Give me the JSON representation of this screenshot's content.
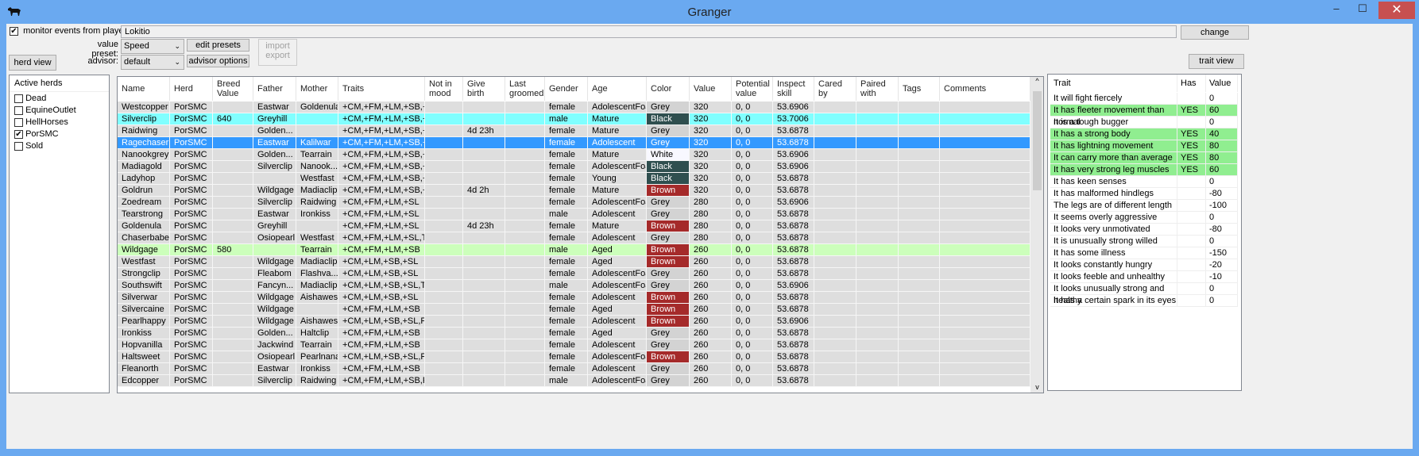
{
  "window": {
    "title": "Granger",
    "minimize": "–",
    "maximize": "☐",
    "close": "✕"
  },
  "top": {
    "monitor_label": "monitor events from players:",
    "monitor_checked": true,
    "players": "Lokitio",
    "change": "change",
    "value_preset_label": "value preset:",
    "value_preset": "Speed",
    "edit_presets": "edit presets",
    "advisor_label": "advisor:",
    "advisor": "default",
    "advisor_options": "advisor options",
    "import_export": [
      "import",
      "export"
    ],
    "herd_view": "herd view",
    "trait_view": "trait view"
  },
  "herds": {
    "title": "Active herds",
    "items": [
      {
        "name": "Dead",
        "checked": false
      },
      {
        "name": "EquineOutlet",
        "checked": false
      },
      {
        "name": "HellHorses",
        "checked": false
      },
      {
        "name": "PorSMC",
        "checked": true
      },
      {
        "name": "Sold",
        "checked": false
      }
    ]
  },
  "grid": {
    "columns": [
      "Name",
      "Herd",
      "Breed Value",
      "Father",
      "Mother",
      "Traits",
      "Not in mood",
      "Give birth",
      "Last groomed",
      "Gender",
      "Age",
      "Color",
      "Value",
      "Potential value",
      "Inspect skill",
      "Cared by",
      "Paired with",
      "Tags",
      "Comments"
    ],
    "colors": {
      "Grey": "#d3d3d3",
      "Black": "#2f4f4f",
      "Brown": "#a52a2a",
      "White": "#f8f8ff",
      "row": "#dedede",
      "highlight": "#80ffff",
      "selected": "#3399ff",
      "breed": "#ccffbb"
    },
    "rows": [
      [
        "Westcopper",
        "PorSMC",
        "",
        "Eastwar",
        "Goldenula",
        "+CM,+FM,+LM,+SB,+SL",
        "",
        "",
        "",
        "female",
        "AdolescentFoal",
        "Grey",
        "320",
        "0, 0",
        "53.6906",
        "",
        "",
        "",
        "",
        ""
      ],
      [
        "Silverclip",
        "PorSMC",
        "640",
        "Greyhill",
        "",
        "+CM,+FM,+LM,+SB,+SL",
        "",
        "",
        "",
        "male",
        "Mature",
        "Black",
        "320",
        "0, 0",
        "53.7006",
        "",
        "",
        "",
        "",
        "highlight"
      ],
      [
        "Raidwing",
        "PorSMC",
        "",
        "Golden...",
        "",
        "+CM,+FM,+LM,+SB,+SL",
        "",
        "4d 23h",
        "",
        "female",
        "Mature",
        "Grey",
        "320",
        "0, 0",
        "53.6878",
        "",
        "",
        "",
        "",
        ""
      ],
      [
        "Ragechaser",
        "PorSMC",
        "",
        "Eastwar",
        "Kalilwar",
        "+CM,+FM,+LM,+SB,+SL",
        "",
        "",
        "",
        "female",
        "Adolescent",
        "Grey",
        "320",
        "0, 0",
        "53.6878",
        "",
        "",
        "",
        "",
        "selected"
      ],
      [
        "Nanookgrey",
        "PorSMC",
        "",
        "Golden...",
        "Tearrain",
        "+CM,+FM,+LM,+SB,+SL",
        "",
        "",
        "",
        "female",
        "Mature",
        "White",
        "320",
        "0, 0",
        "53.6906",
        "",
        "",
        "",
        "",
        ""
      ],
      [
        "Madiagold",
        "PorSMC",
        "",
        "Silverclip",
        "Nanook...",
        "+CM,+FM,+LM,+SB,+SL",
        "",
        "",
        "",
        "female",
        "AdolescentFoal",
        "Black",
        "320",
        "0, 0",
        "53.6906",
        "",
        "",
        "",
        "",
        ""
      ],
      [
        "Ladyhop",
        "PorSMC",
        "",
        "",
        "Westfast",
        "+CM,+FM,+LM,+SB,+SL",
        "",
        "",
        "",
        "female",
        "Young",
        "Black",
        "320",
        "0, 0",
        "53.6878",
        "",
        "",
        "",
        "",
        ""
      ],
      [
        "Goldrun",
        "PorSMC",
        "",
        "Wildgage",
        "Madiaclip",
        "+CM,+FM,+LM,+SB,+SL",
        "",
        "4d 2h",
        "",
        "female",
        "Mature",
        "Brown",
        "320",
        "0, 0",
        "53.6878",
        "",
        "",
        "",
        "",
        ""
      ],
      [
        "Zoedream",
        "PorSMC",
        "",
        "Silverclip",
        "Raidwing",
        "+CM,+FM,+LM,+SL",
        "",
        "",
        "",
        "female",
        "AdolescentFoal",
        "Grey",
        "280",
        "0, 0",
        "53.6906",
        "",
        "",
        "",
        "",
        ""
      ],
      [
        "Tearstrong",
        "PorSMC",
        "",
        "Eastwar",
        "Ironkiss",
        "+CM,+FM,+LM,+SL",
        "",
        "",
        "",
        "male",
        "Adolescent",
        "Grey",
        "280",
        "0, 0",
        "53.6878",
        "",
        "",
        "",
        "",
        ""
      ],
      [
        "Goldenula",
        "PorSMC",
        "",
        "Greyhill",
        "",
        "+CM,+FM,+LM,+SL",
        "",
        "4d 23h",
        "",
        "female",
        "Mature",
        "Brown",
        "280",
        "0, 0",
        "53.6878",
        "",
        "",
        "",
        "",
        ""
      ],
      [
        "Chaserbabe",
        "PorSMC",
        "",
        "Osiopearl",
        "Westfast",
        "+CM,+FM,+LM,+SL,TB",
        "",
        "",
        "",
        "female",
        "Adolescent",
        "Grey",
        "280",
        "0, 0",
        "53.6878",
        "",
        "",
        "",
        "",
        ""
      ],
      [
        "Wildgage",
        "PorSMC",
        "580",
        "",
        "Tearrain",
        "+CM,+FM,+LM,+SB",
        "",
        "",
        "",
        "male",
        "Aged",
        "Brown",
        "260",
        "0, 0",
        "53.6878",
        "",
        "",
        "",
        "",
        "breed"
      ],
      [
        "Westfast",
        "PorSMC",
        "",
        "Wildgage",
        "Madiaclip",
        "+CM,+LM,+SB,+SL",
        "",
        "",
        "",
        "female",
        "Aged",
        "Brown",
        "260",
        "0, 0",
        "53.6878",
        "",
        "",
        "",
        "",
        ""
      ],
      [
        "Strongclip",
        "PorSMC",
        "",
        "Fleabom",
        "Flashva...",
        "+CM,+LM,+SB,+SL",
        "",
        "",
        "",
        "female",
        "AdolescentFoal",
        "Grey",
        "260",
        "0, 0",
        "53.6878",
        "",
        "",
        "",
        "",
        ""
      ],
      [
        "Southswift",
        "PorSMC",
        "",
        "Fancyn...",
        "Madiaclip",
        "+CM,+LM,+SB,+SL,TB",
        "",
        "",
        "",
        "male",
        "AdolescentFoal",
        "Grey",
        "260",
        "0, 0",
        "53.6906",
        "",
        "",
        "",
        "",
        ""
      ],
      [
        "Silverwar",
        "PorSMC",
        "",
        "Wildgage",
        "Aishawest",
        "+CM,+LM,+SB,+SL",
        "",
        "",
        "",
        "female",
        "Adolescent",
        "Brown",
        "260",
        "0, 0",
        "53.6878",
        "",
        "",
        "",
        "",
        ""
      ],
      [
        "Silvercaine",
        "PorSMC",
        "",
        "Wildgage",
        "",
        "+CM,+FM,+LM,+SB",
        "",
        "",
        "",
        "female",
        "Aged",
        "Brown",
        "260",
        "0, 0",
        "53.6878",
        "",
        "",
        "",
        "",
        ""
      ],
      [
        "Pearlhappy",
        "PorSMC",
        "",
        "Wildgage",
        "Aishawest",
        "+CM,+LM,+SB,+SL,FF",
        "",
        "",
        "",
        "female",
        "Adolescent",
        "Brown",
        "260",
        "0, 0",
        "53.6906",
        "",
        "",
        "",
        "",
        ""
      ],
      [
        "Ironkiss",
        "PorSMC",
        "",
        "Golden...",
        "Haltclip",
        "+CM,+FM,+LM,+SB",
        "",
        "",
        "",
        "female",
        "Aged",
        "Grey",
        "260",
        "0, 0",
        "53.6878",
        "",
        "",
        "",
        "",
        ""
      ],
      [
        "Hopvanilla",
        "PorSMC",
        "",
        "Jackwind",
        "Tearrain",
        "+CM,+FM,+LM,+SB",
        "",
        "",
        "",
        "female",
        "Adolescent",
        "Grey",
        "260",
        "0, 0",
        "53.6878",
        "",
        "",
        "",
        "",
        ""
      ],
      [
        "Haltsweet",
        "PorSMC",
        "",
        "Osiopearl",
        "Pearlnana",
        "+CM,+LM,+SB,+SL,FF",
        "",
        "",
        "",
        "female",
        "AdolescentFoal",
        "Brown",
        "260",
        "0, 0",
        "53.6878",
        "",
        "",
        "",
        "",
        ""
      ],
      [
        "Fleanorth",
        "PorSMC",
        "",
        "Eastwar",
        "Ironkiss",
        "+CM,+FM,+LM,+SB",
        "",
        "",
        "",
        "female",
        "Adolescent",
        "Grey",
        "260",
        "0, 0",
        "53.6878",
        "",
        "",
        "",
        "",
        ""
      ],
      [
        "Edcopper",
        "PorSMC",
        "",
        "Silverclip",
        "Raidwing",
        "+CM,+FM,+LM,+SB,FF",
        "",
        "",
        "",
        "male",
        "AdolescentFoal",
        "Grey",
        "260",
        "0, 0",
        "53.6878",
        "",
        "",
        "",
        "",
        ""
      ]
    ]
  },
  "traits": {
    "columns": [
      "Trait",
      "Has",
      "Value"
    ],
    "has_color": "#90ee90",
    "rows": [
      [
        "It will fight fiercely",
        "",
        "0"
      ],
      [
        "It has fleeter movement than normal",
        "YES",
        "60"
      ],
      [
        "It is a tough bugger",
        "",
        "0"
      ],
      [
        "It has a strong body",
        "YES",
        "40"
      ],
      [
        "It has lightning movement",
        "YES",
        "80"
      ],
      [
        "It can carry more than average",
        "YES",
        "80"
      ],
      [
        "It has very strong leg muscles",
        "YES",
        "60"
      ],
      [
        "It has keen senses",
        "",
        "0"
      ],
      [
        "It has malformed hindlegs",
        "",
        "-80"
      ],
      [
        "The legs are of different length",
        "",
        "-100"
      ],
      [
        "It seems overly aggressive",
        "",
        "0"
      ],
      [
        "It looks very unmotivated",
        "",
        "-80"
      ],
      [
        "It is unusually strong willed",
        "",
        "0"
      ],
      [
        "It has some illness",
        "",
        "-150"
      ],
      [
        "It looks constantly hungry",
        "",
        "-20"
      ],
      [
        "It looks feeble and unhealthy",
        "",
        "-10"
      ],
      [
        "It looks unusually strong and healthy",
        "",
        "0"
      ],
      [
        "It has a certain spark in its eyes",
        "",
        "0"
      ]
    ]
  }
}
